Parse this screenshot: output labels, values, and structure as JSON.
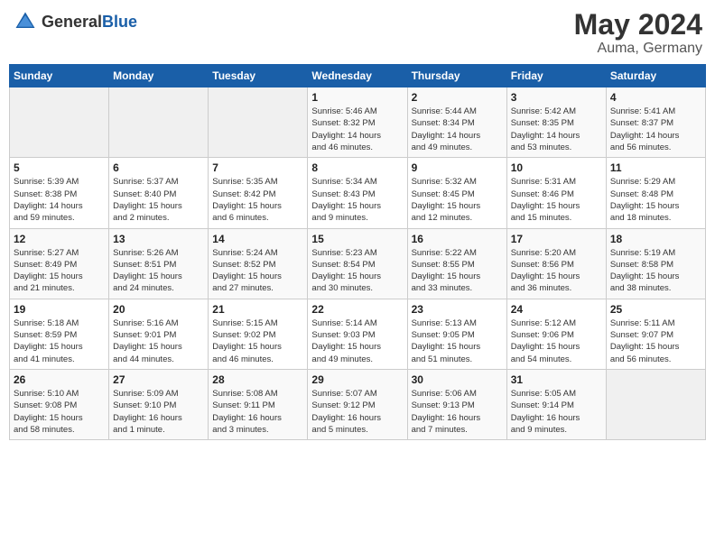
{
  "header": {
    "logo_general": "General",
    "logo_blue": "Blue",
    "month": "May 2024",
    "location": "Auma, Germany"
  },
  "weekdays": [
    "Sunday",
    "Monday",
    "Tuesday",
    "Wednesday",
    "Thursday",
    "Friday",
    "Saturday"
  ],
  "weeks": [
    [
      {
        "day": "",
        "info": ""
      },
      {
        "day": "",
        "info": ""
      },
      {
        "day": "",
        "info": ""
      },
      {
        "day": "1",
        "info": "Sunrise: 5:46 AM\nSunset: 8:32 PM\nDaylight: 14 hours\nand 46 minutes."
      },
      {
        "day": "2",
        "info": "Sunrise: 5:44 AM\nSunset: 8:34 PM\nDaylight: 14 hours\nand 49 minutes."
      },
      {
        "day": "3",
        "info": "Sunrise: 5:42 AM\nSunset: 8:35 PM\nDaylight: 14 hours\nand 53 minutes."
      },
      {
        "day": "4",
        "info": "Sunrise: 5:41 AM\nSunset: 8:37 PM\nDaylight: 14 hours\nand 56 minutes."
      }
    ],
    [
      {
        "day": "5",
        "info": "Sunrise: 5:39 AM\nSunset: 8:38 PM\nDaylight: 14 hours\nand 59 minutes."
      },
      {
        "day": "6",
        "info": "Sunrise: 5:37 AM\nSunset: 8:40 PM\nDaylight: 15 hours\nand 2 minutes."
      },
      {
        "day": "7",
        "info": "Sunrise: 5:35 AM\nSunset: 8:42 PM\nDaylight: 15 hours\nand 6 minutes."
      },
      {
        "day": "8",
        "info": "Sunrise: 5:34 AM\nSunset: 8:43 PM\nDaylight: 15 hours\nand 9 minutes."
      },
      {
        "day": "9",
        "info": "Sunrise: 5:32 AM\nSunset: 8:45 PM\nDaylight: 15 hours\nand 12 minutes."
      },
      {
        "day": "10",
        "info": "Sunrise: 5:31 AM\nSunset: 8:46 PM\nDaylight: 15 hours\nand 15 minutes."
      },
      {
        "day": "11",
        "info": "Sunrise: 5:29 AM\nSunset: 8:48 PM\nDaylight: 15 hours\nand 18 minutes."
      }
    ],
    [
      {
        "day": "12",
        "info": "Sunrise: 5:27 AM\nSunset: 8:49 PM\nDaylight: 15 hours\nand 21 minutes."
      },
      {
        "day": "13",
        "info": "Sunrise: 5:26 AM\nSunset: 8:51 PM\nDaylight: 15 hours\nand 24 minutes."
      },
      {
        "day": "14",
        "info": "Sunrise: 5:24 AM\nSunset: 8:52 PM\nDaylight: 15 hours\nand 27 minutes."
      },
      {
        "day": "15",
        "info": "Sunrise: 5:23 AM\nSunset: 8:54 PM\nDaylight: 15 hours\nand 30 minutes."
      },
      {
        "day": "16",
        "info": "Sunrise: 5:22 AM\nSunset: 8:55 PM\nDaylight: 15 hours\nand 33 minutes."
      },
      {
        "day": "17",
        "info": "Sunrise: 5:20 AM\nSunset: 8:56 PM\nDaylight: 15 hours\nand 36 minutes."
      },
      {
        "day": "18",
        "info": "Sunrise: 5:19 AM\nSunset: 8:58 PM\nDaylight: 15 hours\nand 38 minutes."
      }
    ],
    [
      {
        "day": "19",
        "info": "Sunrise: 5:18 AM\nSunset: 8:59 PM\nDaylight: 15 hours\nand 41 minutes."
      },
      {
        "day": "20",
        "info": "Sunrise: 5:16 AM\nSunset: 9:01 PM\nDaylight: 15 hours\nand 44 minutes."
      },
      {
        "day": "21",
        "info": "Sunrise: 5:15 AM\nSunset: 9:02 PM\nDaylight: 15 hours\nand 46 minutes."
      },
      {
        "day": "22",
        "info": "Sunrise: 5:14 AM\nSunset: 9:03 PM\nDaylight: 15 hours\nand 49 minutes."
      },
      {
        "day": "23",
        "info": "Sunrise: 5:13 AM\nSunset: 9:05 PM\nDaylight: 15 hours\nand 51 minutes."
      },
      {
        "day": "24",
        "info": "Sunrise: 5:12 AM\nSunset: 9:06 PM\nDaylight: 15 hours\nand 54 minutes."
      },
      {
        "day": "25",
        "info": "Sunrise: 5:11 AM\nSunset: 9:07 PM\nDaylight: 15 hours\nand 56 minutes."
      }
    ],
    [
      {
        "day": "26",
        "info": "Sunrise: 5:10 AM\nSunset: 9:08 PM\nDaylight: 15 hours\nand 58 minutes."
      },
      {
        "day": "27",
        "info": "Sunrise: 5:09 AM\nSunset: 9:10 PM\nDaylight: 16 hours\nand 1 minute."
      },
      {
        "day": "28",
        "info": "Sunrise: 5:08 AM\nSunset: 9:11 PM\nDaylight: 16 hours\nand 3 minutes."
      },
      {
        "day": "29",
        "info": "Sunrise: 5:07 AM\nSunset: 9:12 PM\nDaylight: 16 hours\nand 5 minutes."
      },
      {
        "day": "30",
        "info": "Sunrise: 5:06 AM\nSunset: 9:13 PM\nDaylight: 16 hours\nand 7 minutes."
      },
      {
        "day": "31",
        "info": "Sunrise: 5:05 AM\nSunset: 9:14 PM\nDaylight: 16 hours\nand 9 minutes."
      },
      {
        "day": "",
        "info": ""
      }
    ]
  ]
}
